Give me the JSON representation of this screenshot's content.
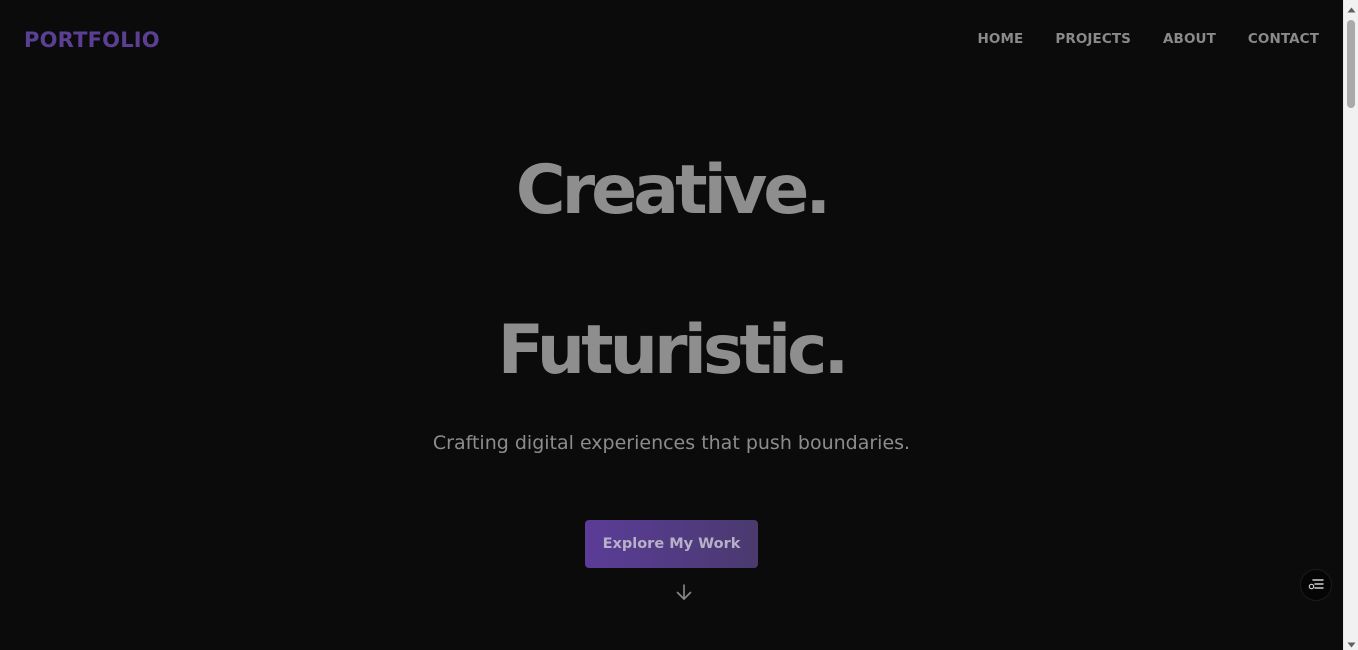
{
  "header": {
    "brand": "PORTFOLIO",
    "nav": [
      {
        "label": "HOME"
      },
      {
        "label": "PROJECTS"
      },
      {
        "label": "ABOUT"
      },
      {
        "label": "CONTACT"
      }
    ]
  },
  "hero": {
    "line1": "Creative.",
    "line2": "Futuristic.",
    "subtitle": "Crafting digital experiences that push boundaries.",
    "cta_label": "Explore My Work"
  },
  "icons": {
    "scroll_down": "arrow-down-icon",
    "fab": "menu-settings-icon",
    "scroll_up": "triangle-up-icon",
    "scroll_down_btn": "triangle-down-icon"
  },
  "colors": {
    "background": "#0b0b0c",
    "brand": "#5b3f93",
    "nav_text": "#8a8a8a",
    "hero_text": "#8e8e8e",
    "cta_start": "#5b3c98",
    "cta_end": "#4a3a6e"
  },
  "scroll": {
    "position_fraction": 0.0
  }
}
